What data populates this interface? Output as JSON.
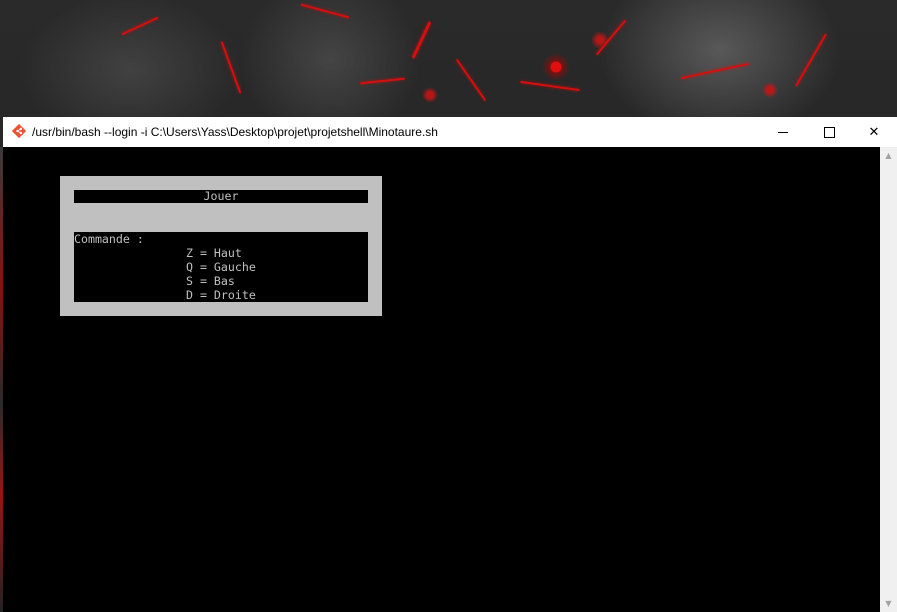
{
  "window": {
    "title": "/usr/bin/bash --login -i C:\\Users\\Yass\\Desktop\\projet\\projetshell\\Minotaure.sh",
    "icon": "git-bash-icon"
  },
  "controls": {
    "minimize": "minimize-icon",
    "maximize": "maximize-icon",
    "close": "close-icon",
    "close_glyph": "✕"
  },
  "scrollbar": {
    "up_glyph": "▲",
    "down_glyph": "▼"
  },
  "menu": {
    "play_label": "Jouer",
    "commands_title": "Commande :",
    "commands": [
      "Z = Haut",
      "Q = Gauche",
      "S = Bas",
      "D = Droite"
    ]
  },
  "colors": {
    "terminal_bg": "#000000",
    "terminal_fg": "#c0c0c0",
    "panel_bg": "#c0c0c0",
    "wallpaper_accent": "#d40f0f"
  }
}
